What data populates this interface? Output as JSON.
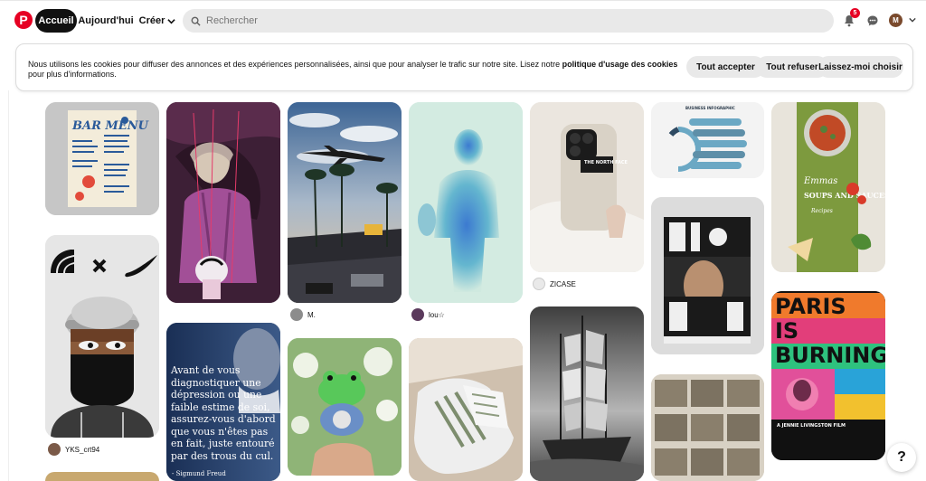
{
  "header": {
    "logo": "P",
    "nav": {
      "home": "Accueil",
      "today": "Aujourd'hui",
      "create": "Créer"
    },
    "search_placeholder": "Rechercher",
    "notifications_count": "5",
    "avatar_initial": "M"
  },
  "cookie": {
    "text_before": "Nous utilisons les cookies pour diffuser des annonces et des expériences personnalisées, ainsi que pour analyser le trafic sur notre site. Lisez notre ",
    "link": "politique d'usage des cookies",
    "text_after": " pour plus d'informations.",
    "accept": "Tout accepter",
    "refuse": "Tout refuser",
    "choose": "Laissez-moi choisir"
  },
  "pins": {
    "bar_menu": {
      "title": "BAR MENU"
    },
    "north_face_owner": "YKS_crt94",
    "quote": {
      "text": "Avant de vous diagnostiquer une dépression ou une faible estime de soi, assurez-vous d'abord que vous n'êtes pas en fait, juste entouré par des trous du cul.",
      "author": "- Sigmund Freud"
    },
    "plane_owner": "M.",
    "blue_owner": "lou☆",
    "phone_owner": "ZICASE",
    "phone_case_text": "THE NORTH FACE",
    "infographic_title": "BUSINESS INFOGRAPHIC",
    "soups": {
      "brand": "Emmas",
      "title": "SOUPS AND SAUCES",
      "sub": "Recipes"
    },
    "paris": {
      "title": "PARIS IS BURNING",
      "sub": "A JENNIE LIVINGSTON FILM"
    }
  },
  "help_label": "?"
}
